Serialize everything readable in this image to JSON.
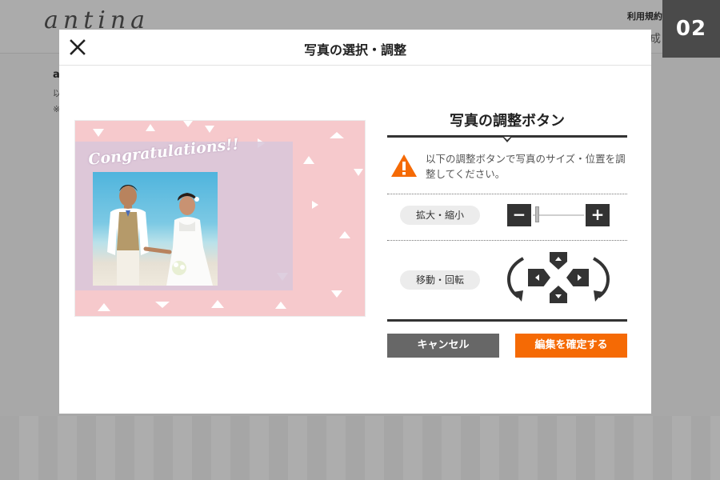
{
  "background": {
    "logo": "antina",
    "header_link": "利用規約",
    "partial_text": "成",
    "side_heading": "a",
    "side_line1": "以",
    "side_line2": "※"
  },
  "step_badge": "02",
  "modal": {
    "title": "写真の選択・調整",
    "close_icon": "close-icon",
    "preview": {
      "overlay_text": "Congratulations!!"
    },
    "panel": {
      "title": "写真の調整ボタン",
      "notice": "以下の調整ボタンで写真のサイズ・位置を調整してください。",
      "zoom": {
        "label": "拡大・縮小",
        "minus": "−",
        "plus": "+",
        "level": 0.05
      },
      "move": {
        "label": "移動・回転"
      },
      "buttons": {
        "cancel": "キャンセル",
        "confirm": "編集を確定する"
      }
    }
  },
  "colors": {
    "accent": "#f56a05",
    "dark": "#333333",
    "preview_bg": "#f6c9cc",
    "cancel_bg": "#676767"
  }
}
